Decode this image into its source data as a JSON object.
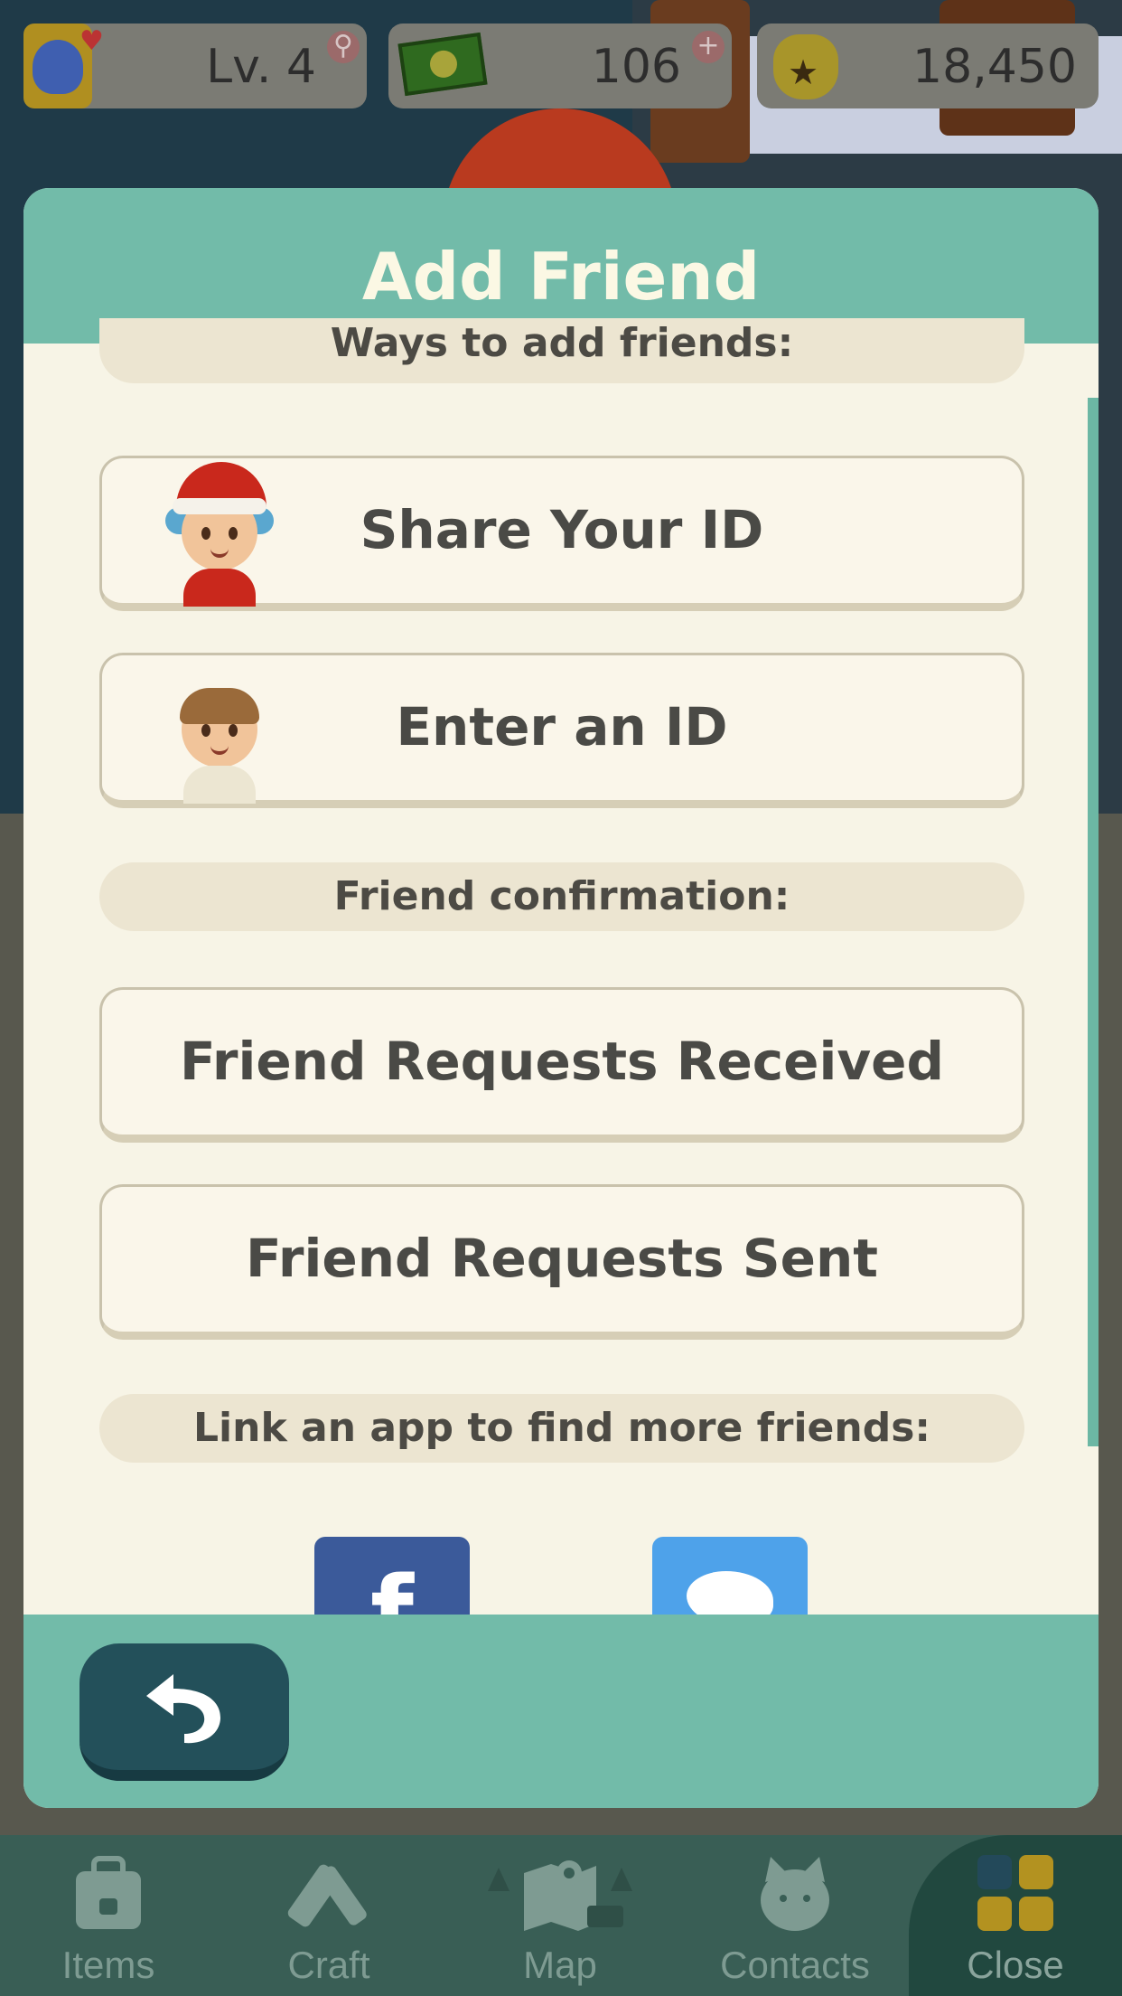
{
  "hud": {
    "level": "Lv. 4",
    "tickets": "106",
    "bells": "18,450",
    "plus_symbol": "+"
  },
  "dialog": {
    "title": "Add Friend",
    "sections": {
      "ways": "Ways to add friends:",
      "confirmation": "Friend confirmation:",
      "link_apps": "Link an app to find more friends:"
    },
    "buttons": {
      "share_id": "Share Your ID",
      "enter_id": "Enter an ID",
      "requests_received": "Friend Requests Received",
      "requests_sent": "Friend Requests Sent"
    },
    "social": {
      "facebook_glyph": "f"
    }
  },
  "nav": {
    "items": "Items",
    "craft": "Craft",
    "map": "Map",
    "contacts": "Contacts",
    "close": "Close"
  },
  "colors": {
    "header_teal": "#72bba9",
    "panel_cream": "#f7f4e6",
    "back_button": "#23505a",
    "facebook": "#3b5a9a",
    "twitter": "#4ea2ea"
  }
}
